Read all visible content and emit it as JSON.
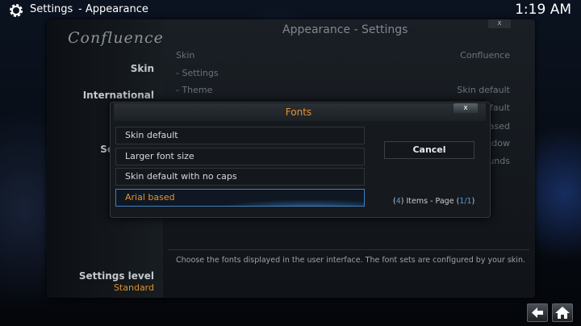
{
  "header": {
    "crumb_main": "Settings",
    "crumb_sub": "- Appearance",
    "clock": "1:19 AM"
  },
  "sidebar": {
    "logo": "Confluence",
    "items": [
      {
        "label": "Skin"
      },
      {
        "label": "International"
      },
      {
        "label": "Sc"
      }
    ],
    "settings_level_label": "Settings level",
    "settings_level_value": "Standard"
  },
  "panel": {
    "title": "Appearance - Settings",
    "close_label": "x",
    "rows": [
      {
        "label": "Skin",
        "value": "Confluence"
      },
      {
        "label": "- Settings",
        "value": ""
      },
      {
        "label": "- Theme",
        "value": "Skin default"
      }
    ],
    "partial_values": [
      "default",
      "ased",
      "ndow",
      "unds"
    ],
    "description": "Choose the fonts displayed in the user interface. The font sets are configured by your skin."
  },
  "dialog": {
    "title": "Fonts",
    "close_label": "x",
    "options": [
      {
        "label": "Skin default",
        "selected": false
      },
      {
        "label": "Larger font size",
        "selected": false
      },
      {
        "label": "Skin default with no caps",
        "selected": false
      },
      {
        "label": "Arial based",
        "selected": true
      }
    ],
    "cancel_label": "Cancel",
    "page_info": {
      "count": "4",
      "middle": "Items - Page",
      "page": "1/1"
    }
  },
  "colors": {
    "accent_orange": "#e8922e",
    "highlight_blue": "#4a9ee8"
  }
}
